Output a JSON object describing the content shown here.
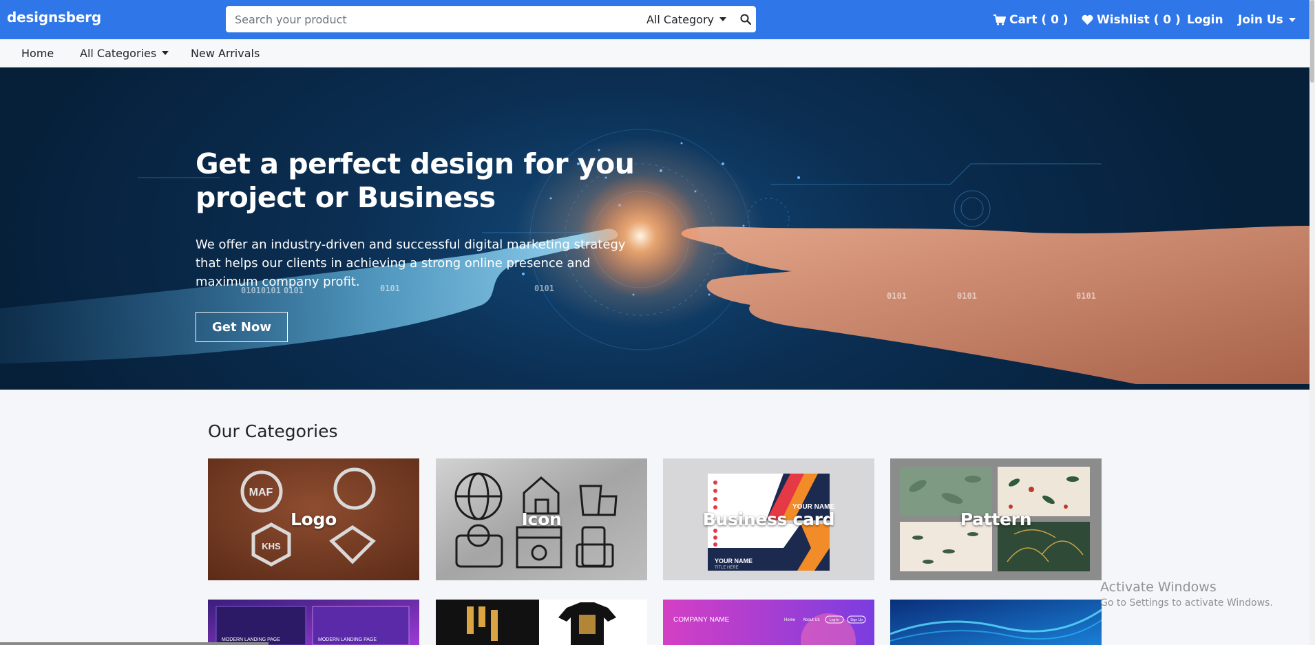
{
  "brand": "designsberg",
  "search": {
    "placeholder": "Search your product",
    "category_label": "All Category"
  },
  "top_nav": {
    "cart": "Cart ( 0 )",
    "wishlist": "Wishlist ( 0 )",
    "login": "Login",
    "join": "Join Us"
  },
  "sub_nav": {
    "home": "Home",
    "all_categories": "All Categories",
    "new_arrivals": "New Arrivals"
  },
  "hero": {
    "title_line1": "Get a perfect design for you",
    "title_line2": "project or Business",
    "text_line1": "We offer an industry-driven and successful digital marketing strategy",
    "text_line2": "that helps our clients in achieving a strong online presence and",
    "text_line3": "maximum company profit.",
    "button": "Get Now",
    "binary": [
      "0101",
      "01010101",
      "0101",
      "0101",
      "0101",
      "0101",
      "0101"
    ]
  },
  "categories": {
    "heading": "Our Categories",
    "items": [
      {
        "label": "Logo"
      },
      {
        "label": "Icon"
      },
      {
        "label": "Business card"
      },
      {
        "label": "Pattern"
      }
    ],
    "preview": {
      "company_name": "COMPANY NAME"
    }
  },
  "card_texts": {
    "logo_monogram": "MAF",
    "logo_hex": "KHS",
    "bizcard_name": "YOUR NAME",
    "bizcard_title": "TITLE HERE",
    "landing_1": "MODERN LANDING PAGE",
    "landing_2": "MODERN LANDING PAGE",
    "nav_home": "Home",
    "nav_about": "About Us",
    "btn_login": "Log In",
    "btn_signup": "Sign Up"
  },
  "watermark": {
    "line1": "Activate Windows",
    "line2": "Go to Settings to activate Windows."
  },
  "colors": {
    "primary": "#2f76e8",
    "hero_dark": "#0b2e52"
  }
}
